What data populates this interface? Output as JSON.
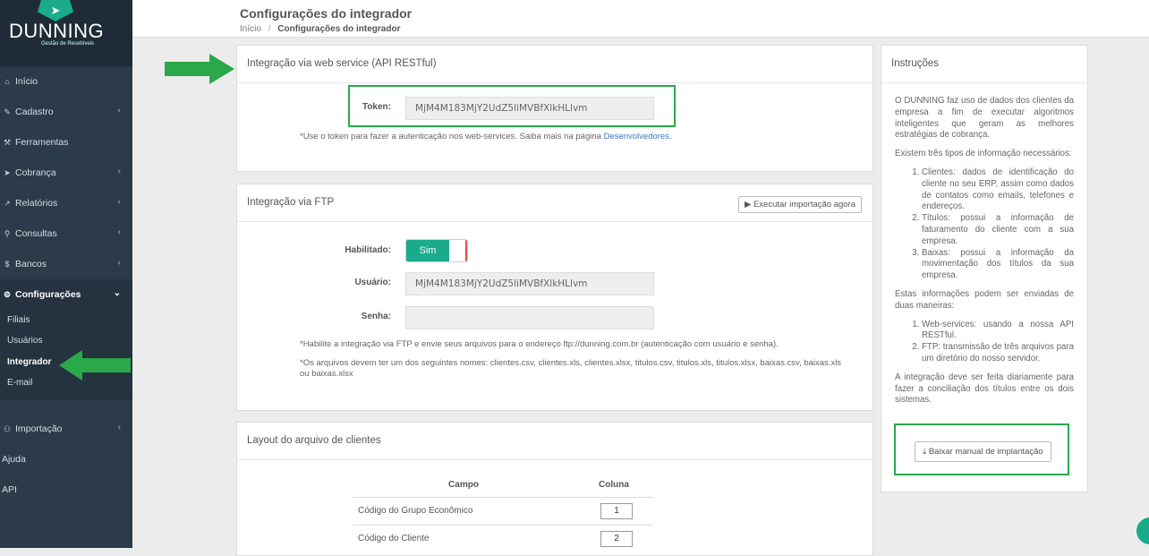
{
  "brand": {
    "name": "DUNNING",
    "tagline": "Gestão de Recebíveis"
  },
  "sidebar": {
    "items": [
      {
        "label": "Início",
        "icon": "home-icon",
        "glyph": "⌂"
      },
      {
        "label": "Cadastro",
        "icon": "edit-icon",
        "glyph": "✎"
      },
      {
        "label": "Ferramentas",
        "icon": "wrench-icon",
        "glyph": "⚒"
      },
      {
        "label": "Cobrança",
        "icon": "send-icon",
        "glyph": "➤"
      },
      {
        "label": "Relatórios",
        "icon": "chart-icon",
        "glyph": "↗"
      },
      {
        "label": "Consultas",
        "icon": "search-icon",
        "glyph": "⚲"
      },
      {
        "label": "Bancos",
        "icon": "dollar-icon",
        "glyph": "$"
      },
      {
        "label": "Configurações",
        "icon": "gear-icon",
        "glyph": "⚙"
      },
      {
        "label": "Importação",
        "icon": "users-icon",
        "glyph": "⚇"
      },
      {
        "label": "Ajuda",
        "icon": "",
        "glyph": ""
      },
      {
        "label": "API",
        "icon": "",
        "glyph": ""
      }
    ],
    "subitems": [
      "Filiais",
      "Usuários",
      "Integrador",
      "E-mail"
    ]
  },
  "header": {
    "title": "Configurações do integrador",
    "crumb_home": "Início",
    "crumb_sep": "/",
    "crumb_current": "Configurações do integrador"
  },
  "webservice": {
    "title": "Integração via web service (API RESTful)",
    "token_label": "Token:",
    "token_value": "MjM4M183MjY2UdZ5liMVBfXlkHLlvm",
    "note_prefix": "*Use o token para fazer a autenticação nos web-services. Saiba mais na página ",
    "note_link": "Desenvolvedores",
    "note_suffix": "."
  },
  "ftp": {
    "title": "Integração via FTP",
    "run_button": "Executar importação agora",
    "enabled_label": "Habilitado:",
    "enabled_value": "Sim",
    "user_label": "Usuário:",
    "user_value": "MjM4M183MjY2UdZ5liMVBfXlkHLlvm",
    "password_label": "Senha:",
    "password_value": "",
    "note1": "*Habilite a integração via FTP e envie seus arquivos para o endereço ftp://dunning.com.br (autenticação com usuário e senha).",
    "note2": "*Os arquivos devem ter um dos seguintes nomes: clientes.csv, clientes.xls, clientes.xlsx, titulos.csv, titulos.xls, titulos.xlsx, baixas.csv, baixas.xls ou baixas.xlsx"
  },
  "layout": {
    "title": "Layout do arquivo de clientes",
    "columns": [
      "Campo",
      "Coluna"
    ],
    "rows": [
      {
        "campo": "Código do Grupo Econômico",
        "coluna": "1"
      },
      {
        "campo": "Código do Cliente",
        "coluna": "2"
      }
    ]
  },
  "instructions": {
    "title": "Instruções",
    "p1": "O DUNNING faz uso de dados dos clientes da empresa a fim de executar algoritmos inteligentes que geram as melhores estratégias de cobrança.",
    "p2": "Existem três tipos de informação necessários:",
    "list1": [
      "Clientes: dados de identificação do cliente no seu ERP, assim como dados de contatos como emails, telefones e endereços.",
      "Títulos: possui a informação de faturamento do cliente com a sua empresa.",
      "Baixas: possui a informação da movimentação dos títulos da sua empresa."
    ],
    "p3": "Estas informações podem ser enviadas de duas maneiras:",
    "list2": [
      "Web-services: usando a nossa API RESTful.",
      "FTP: transmissão de três arquivos para um diretório do nosso servidor."
    ],
    "p4": "A integração deve ser feita diariamente para fazer a conciliação dos títulos entre os dois sistemas.",
    "download_button": "Baixar manual de implantação"
  },
  "colors": {
    "sidebar": "#2c3b49",
    "accent": "#1aaa8c",
    "highlight": "#2aa84a"
  }
}
